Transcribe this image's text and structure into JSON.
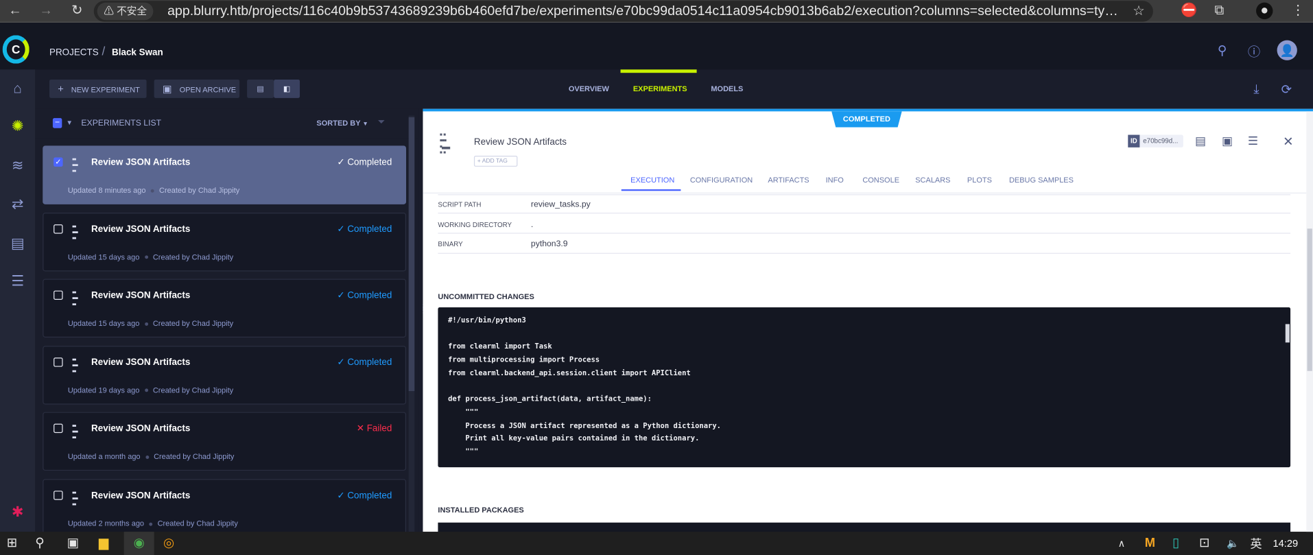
{
  "browser": {
    "insecure_label": "不安全",
    "url": "app.blurry.htb/projects/116c40b9b53743689239b6b460efd7be/experiments/e70bc99da0514c11a0954cb9013b6ab2/execution?columns=selected&columns=type&c..."
  },
  "header": {
    "breadcrumb_root": "PROJECTS",
    "breadcrumb_sep": "/",
    "project_name": "Black Swan",
    "logo_letter": "C"
  },
  "toolbar": {
    "new_experiment": "NEW EXPERIMENT",
    "open_archive": "OPEN ARCHIVE",
    "tabs": [
      {
        "label": "OVERVIEW",
        "active": false
      },
      {
        "label": "EXPERIMENTS",
        "active": true
      },
      {
        "label": "MODELS",
        "active": false
      }
    ]
  },
  "list": {
    "title": "EXPERIMENTS LIST",
    "sorted_by": "SORTED BY",
    "items": [
      {
        "name": "Review JSON Artifacts",
        "status": "✓ Completed",
        "updated": "Updated 8 minutes ago",
        "creator": "Created by Chad Jippity",
        "selected": true
      },
      {
        "name": "Review JSON Artifacts",
        "status": "✓ Completed",
        "updated": "Updated 15 days ago",
        "creator": "Created by Chad Jippity",
        "selected": false
      },
      {
        "name": "Review JSON Artifacts",
        "status": "✓ Completed",
        "updated": "Updated 15 days ago",
        "creator": "Created by Chad Jippity",
        "selected": false
      },
      {
        "name": "Review JSON Artifacts",
        "status": "✓ Completed",
        "updated": "Updated 19 days ago",
        "creator": "Created by Chad Jippity",
        "selected": false
      },
      {
        "name": "Review JSON Artifacts",
        "status": "✕ Failed",
        "updated": "Updated a month ago",
        "creator": "Created by Chad Jippity",
        "selected": false
      },
      {
        "name": "Review JSON Artifacts",
        "status": "✓ Completed",
        "updated": "Updated 2 months ago",
        "creator": "Created by Chad Jippity",
        "selected": false
      }
    ]
  },
  "detail": {
    "status_badge": "COMPLETED",
    "title": "Review JSON Artifacts",
    "add_tag": "+ ADD TAG",
    "id_label": "ID",
    "id_value": "e70bc99d...",
    "tabs": [
      "EXECUTION",
      "CONFIGURATION",
      "ARTIFACTS",
      "INFO",
      "CONSOLE",
      "SCALARS",
      "PLOTS",
      "DEBUG SAMPLES"
    ],
    "active_tab": "EXECUTION",
    "fields": [
      {
        "label": "SCRIPT PATH",
        "value": "review_tasks.py"
      },
      {
        "label": "WORKING DIRECTORY",
        "value": "."
      },
      {
        "label": "BINARY",
        "value": "python3.9"
      }
    ],
    "uncommitted_title": "UNCOMMITTED CHANGES",
    "code": "#!/usr/bin/python3\n\nfrom clearml import Task\nfrom multiprocessing import Process\nfrom clearml.backend_api.session.client import APIClient\n\ndef process_json_artifact(data, artifact_name):\n    \"\"\"\n    Process a JSON artifact represented as a Python dictionary.\n    Print all key-value pairs contained in the dictionary.\n    \"\"\"",
    "installed_title": "INSTALLED PACKAGES"
  },
  "taskbar": {
    "ime": "英",
    "time": "14:29"
  },
  "colors": {
    "accent": "#4d66ff",
    "active_tab": "#c8f000",
    "completed": "#1f9bff",
    "failed": "#ff2e4d",
    "badge": "#1a9bf0"
  }
}
